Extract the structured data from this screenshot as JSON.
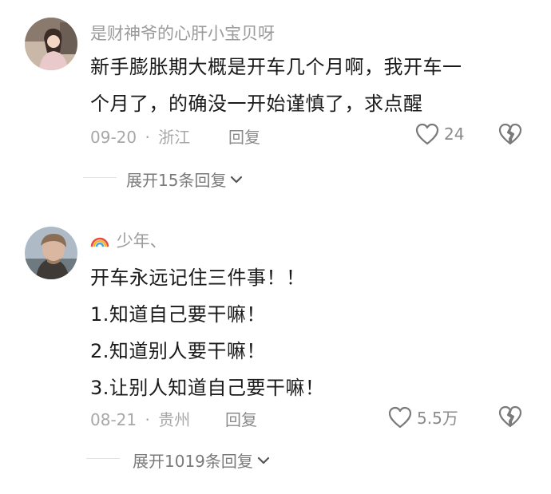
{
  "comments": [
    {
      "username": "是财神爷的心肝小宝贝呀",
      "lines": [
        "新手膨胀期大概是开车几个月啊，我开车一",
        "个月了，的确没一开始谨慎了，求点醒"
      ],
      "date": "09-20",
      "separator": "·",
      "location": "浙江",
      "reply_label": "回复",
      "like_count": "24",
      "expand_label": "展开15条回复"
    },
    {
      "username_prefix_icon": "rainbow-icon",
      "username": "少年、",
      "lines": [
        "开车永远记住三件事！！",
        "1.知道自己要干嘛！",
        "2.知道别人要干嘛！",
        "3.让别人知道自己要干嘛！"
      ],
      "date": "08-21",
      "separator": "·",
      "location": "贵州",
      "reply_label": "回复",
      "like_count": "5.5万",
      "expand_label": "展开1019条回复"
    }
  ],
  "colors": {
    "text": "#1a1a1a",
    "meta": "#a8a8a8",
    "icon": "#7a7a7a"
  }
}
